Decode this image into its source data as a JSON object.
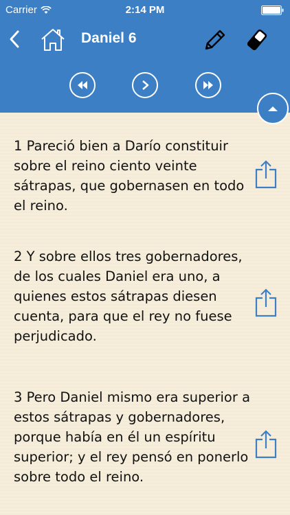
{
  "status": {
    "carrier": "Carrier",
    "time": "2:14 PM"
  },
  "nav": {
    "title": "Daniel 6"
  },
  "colors": {
    "accent": "#3d7fc4",
    "paper": "#f6eedb",
    "text": "#111111"
  },
  "icons": {
    "back": "chevron-left-icon",
    "home": "home-icon",
    "edit": "pencil-icon",
    "erase": "eraser-icon",
    "rewind": "rewind-icon",
    "play": "play-icon",
    "forward": "fast-forward-icon",
    "scroll_top": "chevron-up-icon",
    "share": "share-icon"
  },
  "verses": [
    {
      "text": "1  Pareció bien a Darío constituir sobre el reino ciento veinte sátrapas, que gobernasen en todo el reino."
    },
    {
      "text": "2 Y sobre ellos tres gobernadores, de los cuales Daniel era uno, a quienes estos sátrapas diesen cuenta, para que el rey no fuese perjudicado."
    },
    {
      "text": "3 Pero Daniel mismo era superior a estos sátrapas y gobernadores, porque había en él un espíritu superior; y el rey pensó en ponerlo sobre todo el reino."
    }
  ]
}
